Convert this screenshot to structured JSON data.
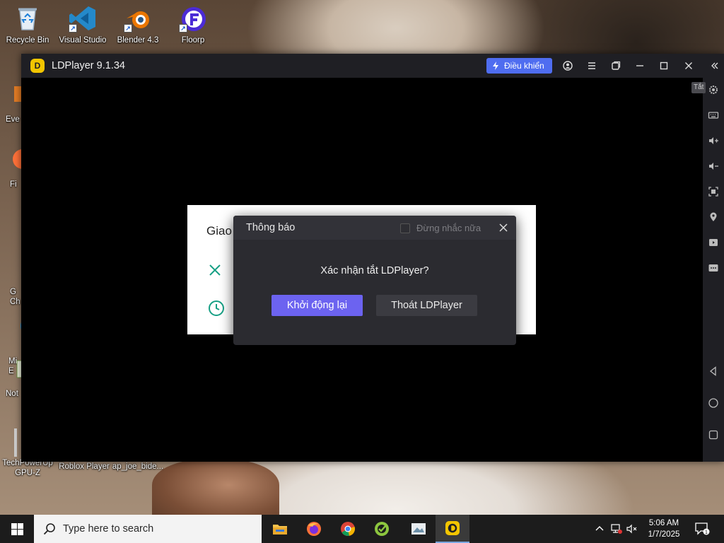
{
  "desktop": {
    "icons": [
      {
        "label": "Recycle Bin",
        "icon": "recycle-bin-icon"
      },
      {
        "label": "Visual Studio",
        "icon": "visual-studio-icon"
      },
      {
        "label": "Blender 4.3",
        "icon": "blender-icon"
      },
      {
        "label": "Floorp",
        "icon": "floorp-icon"
      },
      {
        "label": "Eve",
        "icon": "everything-icon"
      },
      {
        "label": "Fi",
        "icon": "firefox-icon"
      },
      {
        "label": "G\nCh",
        "icon": "chrome-icon"
      },
      {
        "label": "Mi\nE",
        "icon": "edge-icon"
      },
      {
        "label": "Not",
        "icon": "notepad-icon"
      },
      {
        "label": "TechPowerUp GPU-Z",
        "icon": "gpuz-icon"
      },
      {
        "label": "Roblox Player",
        "icon": "roblox-icon"
      },
      {
        "label": "ap_joe_bide...",
        "icon": "file-icon"
      }
    ]
  },
  "ldplayer": {
    "title": "LDPlayer 9.1.34",
    "control_button": "Điều khiển",
    "tooltip": "Tắt",
    "background_panel_title": "Giao",
    "dialog": {
      "title": "Thông báo",
      "dont_remind": "Đừng nhắc nữa",
      "message": "Xác nhận tắt LDPlayer?",
      "restart_button": "Khởi động lại",
      "exit_button": "Thoát LDPlayer"
    },
    "colors": {
      "accent": "#6c63f0",
      "control": "#4f6df0",
      "titlebar": "#1f1f24",
      "dialog": "#2b2b30"
    }
  },
  "taskbar": {
    "search_placeholder": "Type here to search",
    "apps": [
      "file-explorer-icon",
      "firefox-icon",
      "chrome-icon",
      "app-icon",
      "photos-icon",
      "ldplayer-icon"
    ],
    "time": "5:06 AM",
    "date": "1/7/2025"
  }
}
